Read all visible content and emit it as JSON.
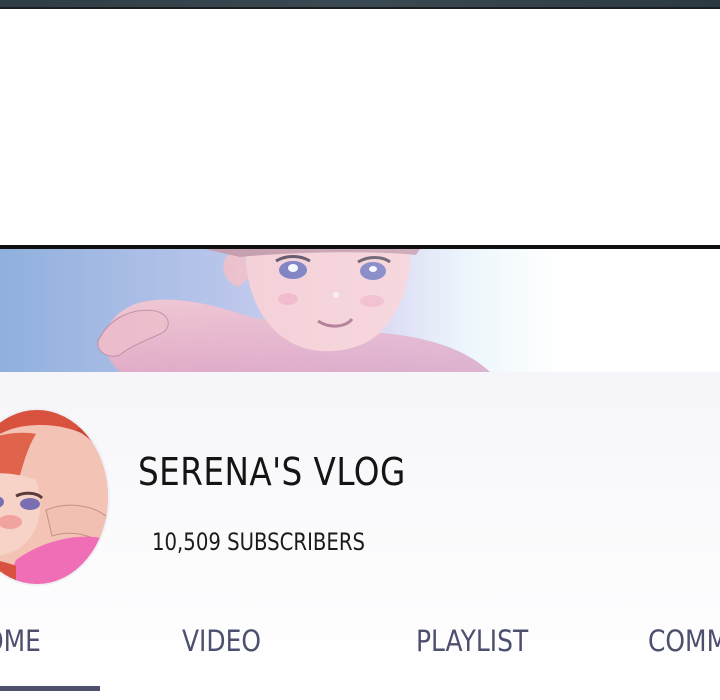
{
  "channel": {
    "name": "SERENA'S VLOG",
    "subscribers": "10,509 SUBSCRIBERS"
  },
  "tabs": [
    {
      "label": "OME",
      "active": true
    },
    {
      "label": "VIDEO",
      "active": false
    },
    {
      "label": "PLAYLIST",
      "active": false
    },
    {
      "label": "COMM",
      "active": false
    }
  ],
  "colors": {
    "tab_text": "#4c4f6e",
    "tab_indicator": "#4c4f6e",
    "title_text": "#141414",
    "panel_border": "#111111"
  },
  "icons": {
    "avatar": "profile-avatar-illustration",
    "banner": "channel-banner-illustration"
  }
}
